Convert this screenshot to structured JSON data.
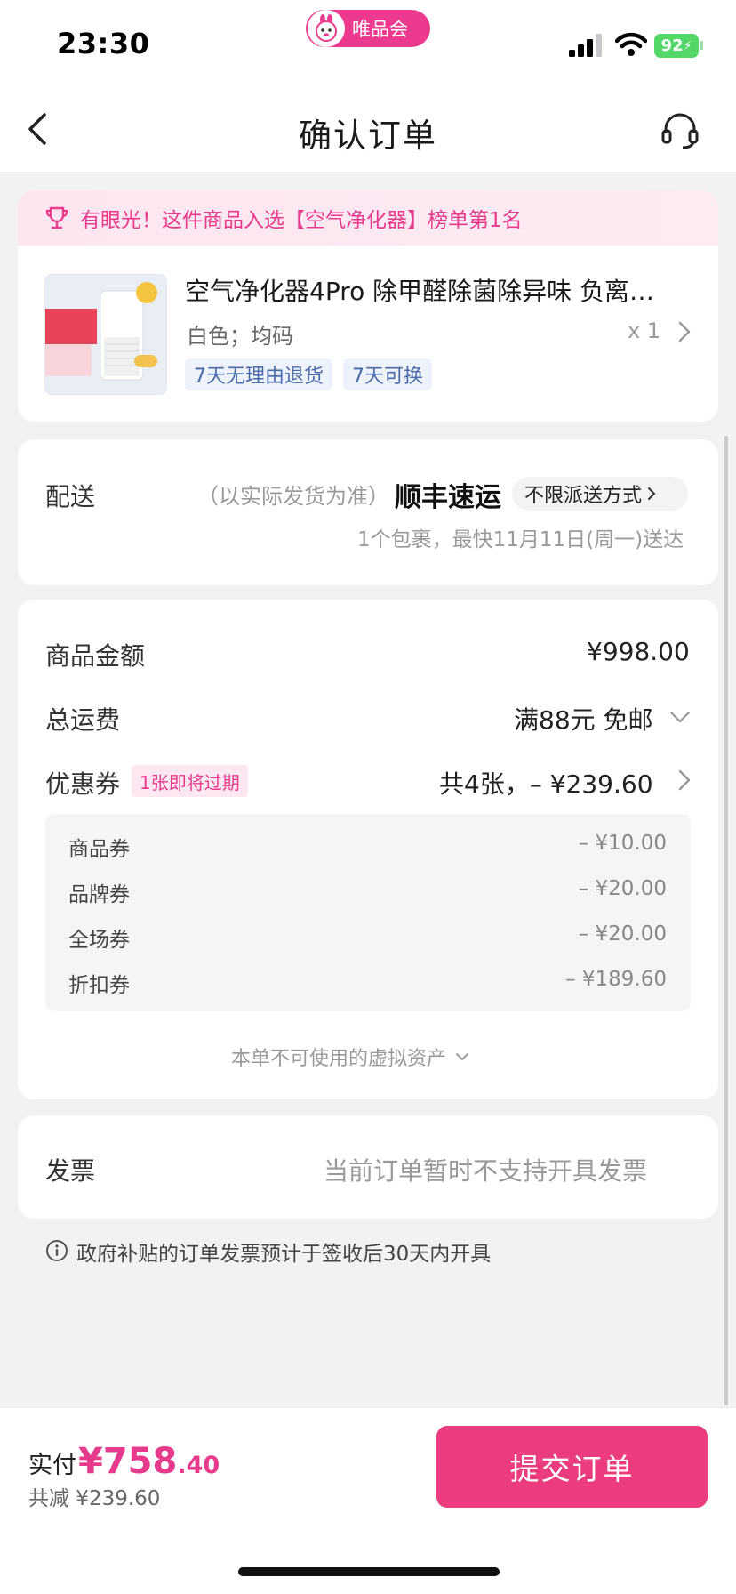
{
  "status_bar": {
    "time": "23:30",
    "brand": "唯品会",
    "battery": "92"
  },
  "nav": {
    "title": "确认订单"
  },
  "rank_banner": {
    "text": "有眼光！这件商品入选【空气净化器】榜单第1名"
  },
  "product": {
    "name": "空气净化器4Pro 除甲醛除菌除异味 负离…",
    "spec": "白色；均码",
    "qty": "x 1",
    "tags": [
      "7天无理由退货",
      "7天可换"
    ]
  },
  "delivery": {
    "label": "配送",
    "note": "（以实际发货为准）",
    "carrier": "顺丰速运",
    "method_button": "不限派送方式",
    "estimate": "1个包裹，最快11月11日(周一)送达"
  },
  "price": {
    "goods_label": "商品金额",
    "goods_value": "¥998.00",
    "shipping_label": "总运费",
    "shipping_value": "满88元 免邮",
    "coupon_label": "优惠券",
    "coupon_badge": "1张即将过期",
    "coupon_value": "共4张，– ¥239.60",
    "coupons": [
      {
        "name": "商品券",
        "amount": "– ¥10.00"
      },
      {
        "name": "品牌券",
        "amount": "– ¥20.00"
      },
      {
        "name": "全场券",
        "amount": "– ¥20.00"
      },
      {
        "name": "折扣券",
        "amount": "– ¥189.60"
      }
    ],
    "virtual_assets": "本单不可使用的虚拟资产"
  },
  "invoice": {
    "label": "发票",
    "value": "当前订单暂时不支持开具发票",
    "notice": "政府补贴的订单发票预计于签收后30天内开具"
  },
  "footer": {
    "pay_label": "实付",
    "pay_int": "¥758",
    "pay_dec": ".40",
    "saved": "共减 ¥239.60",
    "submit": "提交订单"
  },
  "colors": {
    "accent": "#ea3c7e",
    "banner_text": "#e63a8c",
    "tag_text": "#4b6aa8"
  }
}
